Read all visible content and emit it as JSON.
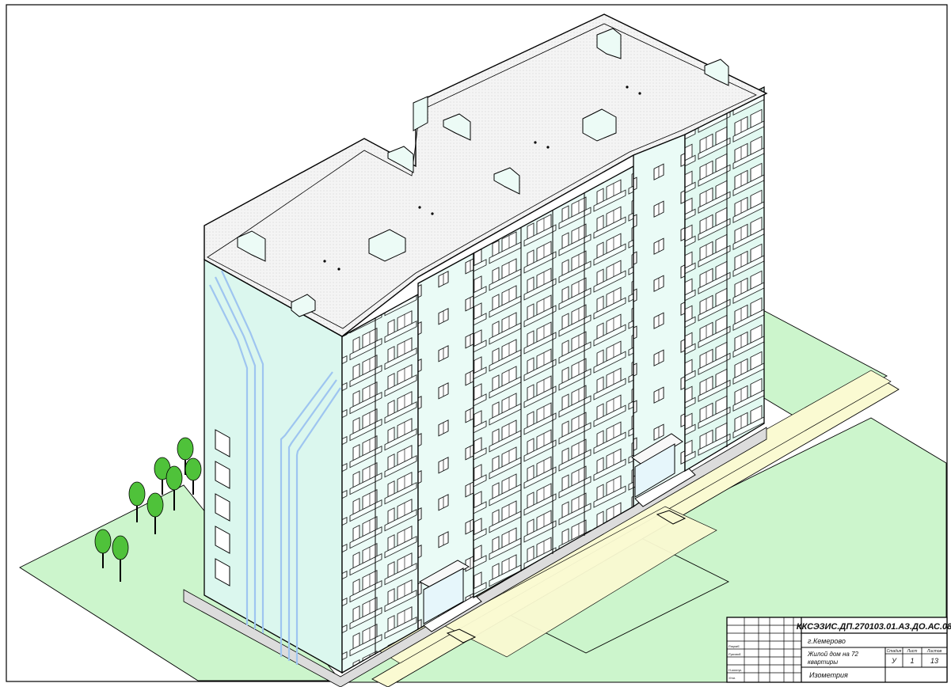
{
  "title_block": {
    "code": "ККСЭЗИС.ДП.270103.01.АЗ.ДО.АС.08",
    "city": "г.Кемерово",
    "object_line1": "Жилой дом на 72",
    "object_line2": "квартиры",
    "sheet_title": "Изометрия",
    "col_stage": "Стадия",
    "col_sheet": "Лист",
    "col_sheets": "Листов",
    "stage": "У",
    "sheet": "1",
    "sheets": "13",
    "approval_labels": [
      "Разраб.",
      "Руковод.",
      "Н.контр.",
      "Утв."
    ]
  },
  "colors": {
    "ground": "#ccf5cc",
    "facade": "#e9fbf5",
    "facade_side": "#d8f6ec",
    "roof": "#f3f3f3",
    "sidewalk": "#fafad2",
    "tree": "#4fc23a",
    "stripe": "#9ec5f0",
    "line": "#000000"
  }
}
